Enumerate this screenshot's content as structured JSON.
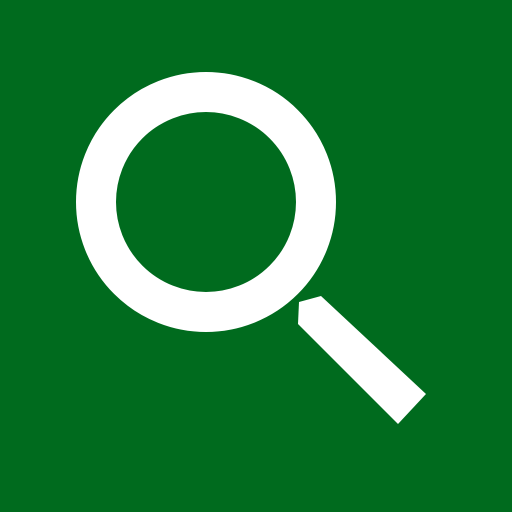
{
  "app_tile": {
    "icon": "search-icon",
    "background_color": "#006b1e",
    "icon_color": "#ffffff"
  }
}
